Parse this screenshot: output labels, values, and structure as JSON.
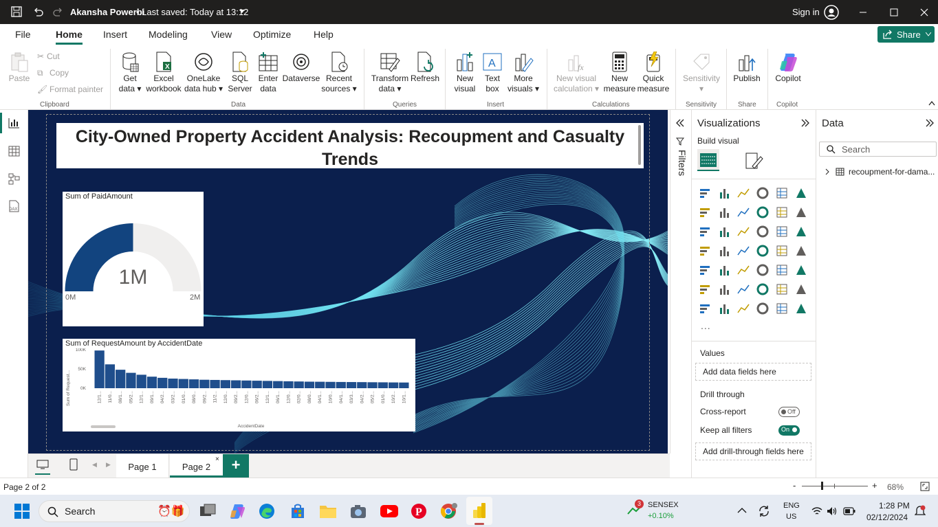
{
  "title_bar": {
    "title": "Akansha Powerbi",
    "saved": "• Last saved: Today at 13:12",
    "sign_in": "Sign in"
  },
  "menu": {
    "tabs": [
      "File",
      "Home",
      "Insert",
      "Modeling",
      "View",
      "Optimize",
      "Help"
    ],
    "active": "Home",
    "share": "Share"
  },
  "ribbon": {
    "clipboard": {
      "paste": "Paste",
      "cut": "Cut",
      "copy": "Copy",
      "format_painter": "Format painter",
      "group": "Clipboard"
    },
    "data": {
      "get_data_1": "Get",
      "get_data_2": "data",
      "excel_1": "Excel",
      "excel_2": "workbook",
      "onelake_1": "OneLake",
      "onelake_2": "data hub",
      "sql_1": "SQL",
      "sql_2": "Server",
      "enter_1": "Enter",
      "enter_2": "data",
      "dataverse": "Dataverse",
      "recent_1": "Recent",
      "recent_2": "sources",
      "group": "Data"
    },
    "queries": {
      "transform_1": "Transform",
      "transform_2": "data",
      "refresh": "Refresh",
      "group": "Queries"
    },
    "insert": {
      "new_visual_1": "New",
      "new_visual_2": "visual",
      "text_box_1": "Text",
      "text_box_2": "box",
      "more_1": "More",
      "more_2": "visuals",
      "group": "Insert"
    },
    "calculations": {
      "new_calc_1": "New visual",
      "new_calc_2": "calculation",
      "new_measure_1": "New",
      "new_measure_2": "measure",
      "quick_1": "Quick",
      "quick_2": "measure",
      "group": "Calculations"
    },
    "sensitivity": {
      "label": "Sensitivity",
      "group": "Sensitivity"
    },
    "share": {
      "publish": "Publish",
      "group": "Share"
    },
    "copilot": {
      "label": "Copilot",
      "group": "Copilot"
    }
  },
  "report": {
    "title": "City-Owned Property Accident Analysis: Recoupment and Casualty Trends",
    "gauge": {
      "title": "Sum of PaidAmount",
      "value": "1M",
      "min": "0M",
      "max": "2M",
      "fraction": 0.5
    },
    "chart_title": "Sum of RequestAmount by AccidentDate",
    "colors": {
      "canvas": "#0b1f4d",
      "bar": "#1f4e8c",
      "gauge_fill": "#12447f",
      "gauge_empty": "#f0efee"
    }
  },
  "chart_data": {
    "type": "bar",
    "title": "Sum of RequestAmount by AccidentDate",
    "xlabel": "AccidentDate",
    "ylabel": "Sum of Request...",
    "yticks": [
      "100K",
      "50K",
      "0K"
    ],
    "ylim": [
      0,
      100000
    ],
    "categories": [
      "12/1...",
      "11/0...",
      "08/1...",
      "05/2...",
      "12/1...",
      "09/1...",
      "04/2...",
      "03/2...",
      "01/0...",
      "08/0...",
      "09/2...",
      "11/2...",
      "12/0...",
      "09/2...",
      "12/0...",
      "06/2...",
      "12/1...",
      "06/1...",
      "12/0...",
      "02/0...",
      "08/0...",
      "04/1...",
      "10/0...",
      "04/1...",
      "03/3...",
      "04/2...",
      "05/2...",
      "01/0...",
      "10/2...",
      "10/1..."
    ],
    "values": [
      98000,
      62000,
      48000,
      40000,
      35000,
      30000,
      27000,
      25000,
      24000,
      23000,
      22000,
      21500,
      21000,
      20500,
      20000,
      19500,
      19000,
      18500,
      18000,
      17500,
      17000,
      16800,
      16500,
      16200,
      16000,
      15800,
      15500,
      15300,
      15000,
      14800
    ]
  },
  "filters_label": "Filters",
  "visualizations": {
    "title": "Visualizations",
    "build": "Build visual",
    "values_label": "Values",
    "values_placeholder": "Add data fields here",
    "drill_label": "Drill through",
    "cross_report": "Cross-report",
    "cross_state": "Off",
    "keep_filters": "Keep all filters",
    "keep_state": "On",
    "drill_placeholder": "Add drill-through fields here",
    "more": "..."
  },
  "data_pane": {
    "title": "Data",
    "search_placeholder": "Search",
    "table": "recoupment-for-dama..."
  },
  "pages": {
    "tabs": [
      "Page 1",
      "Page 2"
    ],
    "active": "Page 2"
  },
  "status": {
    "page": "Page 2 of 2",
    "zoom": "68%"
  },
  "taskbar": {
    "search": "Search",
    "sensex": "SENSEX",
    "sensex_change": "+0.10%",
    "badge": "3",
    "lang_1": "ENG",
    "lang_2": "US",
    "time": "1:28 PM",
    "date": "02/12/2024"
  }
}
